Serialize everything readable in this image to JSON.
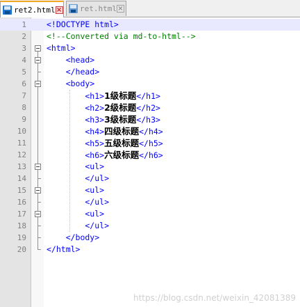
{
  "tabs": [
    {
      "label": "ret2.html",
      "active": true
    },
    {
      "label": "ret.html",
      "active": false
    }
  ],
  "lines": [
    {
      "n": "1",
      "parts": [
        {
          "c": "tag",
          "t": "<!DOCTYPE html>"
        }
      ]
    },
    {
      "n": "2",
      "parts": [
        {
          "c": "cmt",
          "t": "<!--Converted via md-to-html-->"
        }
      ]
    },
    {
      "n": "3",
      "parts": [
        {
          "c": "tag",
          "t": "<html>"
        }
      ]
    },
    {
      "n": "4",
      "parts": [
        {
          "c": "tag",
          "t": "    <head>"
        }
      ]
    },
    {
      "n": "5",
      "parts": [
        {
          "c": "tag",
          "t": "    </head>"
        }
      ]
    },
    {
      "n": "6",
      "parts": [
        {
          "c": "tag",
          "t": "    <body>"
        }
      ]
    },
    {
      "n": "7",
      "parts": [
        {
          "c": "tag",
          "t": "        <h1>"
        },
        {
          "c": "txt",
          "t": "1级标题"
        },
        {
          "c": "tag",
          "t": "</h1>"
        }
      ]
    },
    {
      "n": "8",
      "parts": [
        {
          "c": "tag",
          "t": "        <h2>"
        },
        {
          "c": "txt",
          "t": "2级标题"
        },
        {
          "c": "tag",
          "t": "</h2>"
        }
      ]
    },
    {
      "n": "9",
      "parts": [
        {
          "c": "tag",
          "t": "        <h3>"
        },
        {
          "c": "txt",
          "t": "3级标题"
        },
        {
          "c": "tag",
          "t": "</h3>"
        }
      ]
    },
    {
      "n": "10",
      "parts": [
        {
          "c": "tag",
          "t": "        <h4>"
        },
        {
          "c": "txt",
          "t": "四级标题"
        },
        {
          "c": "tag",
          "t": "</h4>"
        }
      ]
    },
    {
      "n": "11",
      "parts": [
        {
          "c": "tag",
          "t": "        <h5>"
        },
        {
          "c": "txt",
          "t": "五级标题"
        },
        {
          "c": "tag",
          "t": "</h5>"
        }
      ]
    },
    {
      "n": "12",
      "parts": [
        {
          "c": "tag",
          "t": "        <h6>"
        },
        {
          "c": "txt",
          "t": "六级标题"
        },
        {
          "c": "tag",
          "t": "</h6>"
        }
      ]
    },
    {
      "n": "13",
      "parts": [
        {
          "c": "tag",
          "t": "        <ul>"
        }
      ]
    },
    {
      "n": "14",
      "parts": [
        {
          "c": "tag",
          "t": "        </ul>"
        }
      ]
    },
    {
      "n": "15",
      "parts": [
        {
          "c": "tag",
          "t": "        <ul>"
        }
      ]
    },
    {
      "n": "16",
      "parts": [
        {
          "c": "tag",
          "t": "        </ul>"
        }
      ]
    },
    {
      "n": "17",
      "parts": [
        {
          "c": "tag",
          "t": "        <ul>"
        }
      ]
    },
    {
      "n": "18",
      "parts": [
        {
          "c": "tag",
          "t": "        </ul>"
        }
      ]
    },
    {
      "n": "19",
      "parts": [
        {
          "c": "tag",
          "t": "    </body>"
        }
      ]
    },
    {
      "n": "20",
      "parts": [
        {
          "c": "tag",
          "t": "</html>"
        }
      ]
    }
  ],
  "fold_markers": {
    "3": "open",
    "4": "open",
    "6": "open",
    "13": "open",
    "15": "open",
    "17": "open",
    "20": "end"
  },
  "current_line": "1",
  "watermark": "https://blog.csdn.net/weixin_42081389",
  "colors": {
    "tag": "#0000ff",
    "comment": "#008000",
    "text": "#000000",
    "current_line": "#e8e8ff"
  }
}
